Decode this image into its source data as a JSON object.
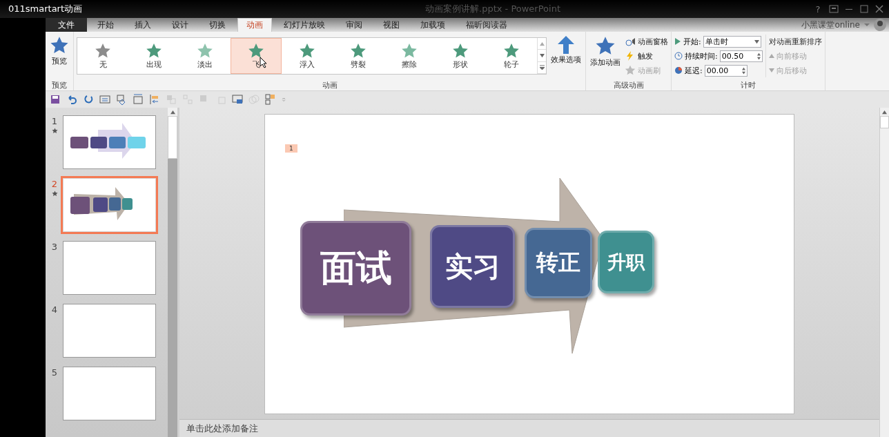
{
  "overlay_title": "011smartart动画",
  "window": {
    "title": "动画案例讲解.pptx - PowerPoint",
    "help": "?"
  },
  "file_tab": "文件",
  "tabs": [
    {
      "label": "开始",
      "selected": false
    },
    {
      "label": "插入",
      "selected": false
    },
    {
      "label": "设计",
      "selected": false
    },
    {
      "label": "切换",
      "selected": false
    },
    {
      "label": "动画",
      "selected": true
    },
    {
      "label": "幻灯片放映",
      "selected": false
    },
    {
      "label": "审阅",
      "selected": false
    },
    {
      "label": "视图",
      "selected": false
    },
    {
      "label": "加载项",
      "selected": false
    },
    {
      "label": "福昕阅读器",
      "selected": false
    }
  ],
  "account": "小黑课堂online",
  "ribbon": {
    "preview": {
      "button": "预览",
      "group": "预览"
    },
    "gallery": {
      "group": "动画",
      "items": [
        {
          "label": "无",
          "kind": "none",
          "selected": false
        },
        {
          "label": "出现",
          "kind": "appear",
          "selected": false
        },
        {
          "label": "淡出",
          "kind": "fade",
          "selected": false
        },
        {
          "label": "飞",
          "kind": "fly",
          "selected": true
        },
        {
          "label": "浮入",
          "kind": "float",
          "selected": false
        },
        {
          "label": "劈裂",
          "kind": "split",
          "selected": false
        },
        {
          "label": "擦除",
          "kind": "wipe",
          "selected": false
        },
        {
          "label": "形状",
          "kind": "shape",
          "selected": false
        },
        {
          "label": "轮子",
          "kind": "wheel",
          "selected": false
        }
      ],
      "effect_options": "效果选项"
    },
    "advanced": {
      "group": "高级动画",
      "add": "添加动画",
      "pane": "动画窗格",
      "trigger": "触发",
      "painter": "动画刷",
      "painter_disabled": true
    },
    "timing": {
      "group": "计时",
      "start_label": "开始:",
      "start_value": "单击时",
      "duration_label": "持续时间:",
      "duration_value": "00.50",
      "delay_label": "延迟:",
      "delay_value": "00.00",
      "reorder_title": "对动画重新排序",
      "earlier": "向前移动",
      "later": "向后移动",
      "reorder_disabled": true
    }
  },
  "slides": [
    {
      "number": "1",
      "animated": true,
      "selected": false,
      "kind": "smartart"
    },
    {
      "number": "2",
      "animated": true,
      "selected": true,
      "kind": "smartart3d"
    },
    {
      "number": "3",
      "animated": false,
      "selected": false,
      "kind": "blank"
    },
    {
      "number": "4",
      "animated": false,
      "selected": false,
      "kind": "blank"
    },
    {
      "number": "5",
      "animated": false,
      "selected": false,
      "kind": "blank"
    }
  ],
  "slide": {
    "animation_tag": "1",
    "diagram": [
      {
        "text": "面试",
        "color": "#6d5179"
      },
      {
        "text": "实习",
        "color": "#4f4a85"
      },
      {
        "text": "转正",
        "color": "#456893"
      },
      {
        "text": "升职",
        "color": "#3f9090"
      }
    ]
  },
  "notes": {
    "placeholder": "单击此处添加备注"
  }
}
